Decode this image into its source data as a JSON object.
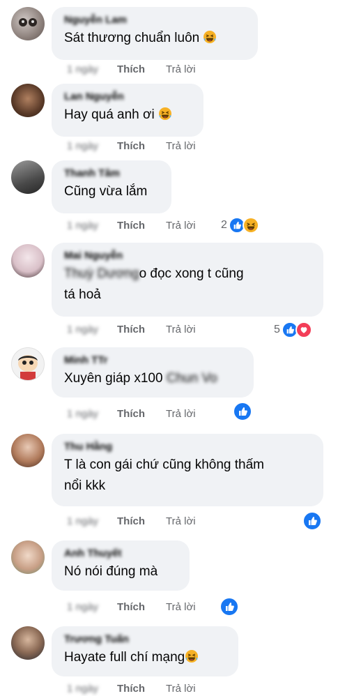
{
  "actions": {
    "like_label": "Thích",
    "reply_label": "Trả lời"
  },
  "comments": [
    {
      "name": "Nguyễn Lam",
      "text": "Sát thương chuẩn luôn",
      "emoji": "laughing-emoji",
      "time": "1 ngày",
      "reaction_count": "",
      "reactions": []
    },
    {
      "name": "Lan Nguyễn",
      "text": "Hay quá anh ơi",
      "emoji": "laughing-emoji",
      "time": "1 ngày",
      "reaction_count": "",
      "reactions": []
    },
    {
      "name": "Thanh Tâm",
      "text": "Cũng vừa lắm",
      "emoji": "",
      "time": "1 ngày",
      "reaction_count": "2",
      "reactions": [
        "like",
        "haha"
      ]
    },
    {
      "name": "Mai Nguyễn",
      "text_blurred": "Thuỳ Dương",
      "text_1": "o đọc xong t cũng",
      "text_2": "tá hoả",
      "time": "1 ngày",
      "reaction_count": "5",
      "reactions": [
        "like",
        "love"
      ]
    },
    {
      "name": "Minh TTr",
      "text": "Xuyên giáp x100",
      "text_blurred": "Chun Vo",
      "time": "1 ngày",
      "reaction_count": "",
      "reactions": [
        "like"
      ]
    },
    {
      "name": "Thu Hằng",
      "text_1": "T là con gái chứ cũng không thấm",
      "text_2": "nổi kkk",
      "time": "1 ngày",
      "reaction_count": "",
      "reactions": [
        "like"
      ]
    },
    {
      "name": "Anh Thuyết",
      "text": "Nó nói đúng mà",
      "time": "1 ngày",
      "reaction_count": "",
      "reactions": [
        "like"
      ]
    },
    {
      "name": "Trương Tuấn",
      "text": "Hayate full chí mạng",
      "emoji": "laughing-emoji",
      "time": "1 ngày",
      "reaction_count": "",
      "reactions": []
    }
  ]
}
